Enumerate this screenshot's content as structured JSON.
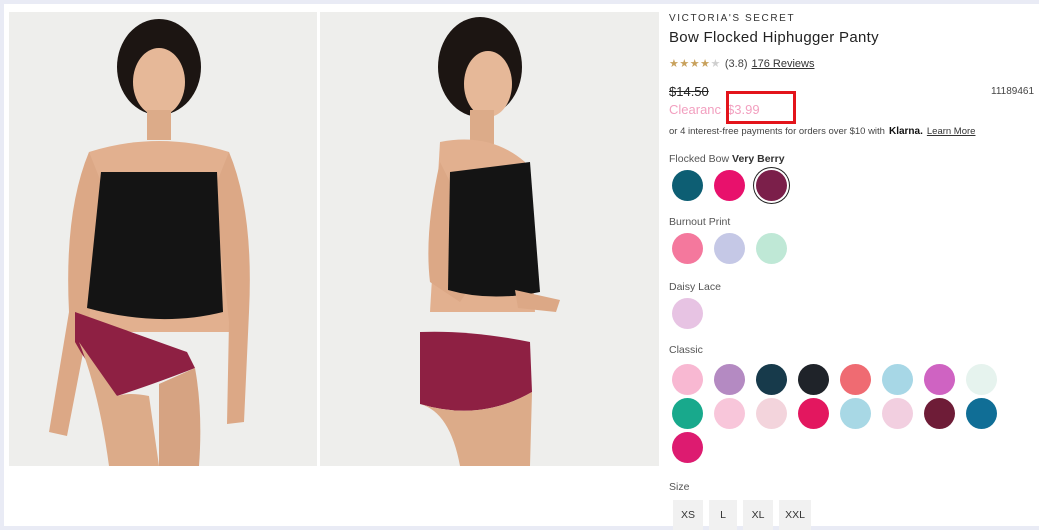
{
  "product": {
    "brand": "VICTORIA'S SECRET",
    "title": "Bow Flocked Hiphugger Panty",
    "rating": "(3.8)",
    "stars_filled": 4,
    "stars_total": 5,
    "reviews": "176 Reviews",
    "original_price": "$14.50",
    "sale_label": "Clearanc",
    "sale_price": "$3.99",
    "sku": "11189461",
    "klarna_text": "or 4 interest-free payments for orders over $10 with",
    "klarna_logo": "Klarna.",
    "learn_more": "Learn More"
  },
  "colors": {
    "accent_pink": "#f29fbf",
    "highlight_red": "#e3141b",
    "star_gold": "#c8a15c"
  },
  "swatch_groups": [
    {
      "label": "Flocked Bow",
      "selected": "Very Berry",
      "swatches": [
        {
          "name": "teal",
          "color": "#0d5e73"
        },
        {
          "name": "hot-pink",
          "color": "#e8116c"
        },
        {
          "name": "very-berry",
          "color": "#7b1f4a",
          "selected": true
        }
      ]
    },
    {
      "label": "Burnout Print",
      "swatches": [
        {
          "name": "pink-burnout",
          "color": "#f4789d"
        },
        {
          "name": "lavender-burnout",
          "color": "#c5c8e6"
        },
        {
          "name": "mint-burnout",
          "color": "#bfe8d6"
        }
      ]
    },
    {
      "label": "Daisy Lace",
      "swatches": [
        {
          "name": "lilac-lace",
          "color": "#e7c3e3"
        }
      ]
    },
    {
      "label": "Classic",
      "swatches": [
        {
          "name": "light-pink",
          "color": "#f8b8d2"
        },
        {
          "name": "purple-floral",
          "color": "#b48ac2"
        },
        {
          "name": "navy-floral",
          "color": "#173a4b"
        },
        {
          "name": "black-floral",
          "color": "#1f2329"
        },
        {
          "name": "coral",
          "color": "#ef6b72"
        },
        {
          "name": "light-blue",
          "color": "#a7d7e6"
        },
        {
          "name": "orchid",
          "color": "#cf63c2"
        },
        {
          "name": "white-stripe",
          "color": "#e6f3ee"
        },
        {
          "name": "emerald",
          "color": "#18a98c"
        },
        {
          "name": "blush",
          "color": "#f8c6da"
        },
        {
          "name": "pink-dot",
          "color": "#f3d4dc"
        },
        {
          "name": "fuchsia-stripe",
          "color": "#e3175f"
        },
        {
          "name": "sky-print",
          "color": "#a8d8e5"
        },
        {
          "name": "pink-tie-dye",
          "color": "#f2cfe0"
        },
        {
          "name": "burgundy-floral",
          "color": "#6e1c37"
        },
        {
          "name": "ocean-blue",
          "color": "#106e96"
        },
        {
          "name": "magenta-print",
          "color": "#dd1b70"
        }
      ]
    }
  ],
  "size": {
    "label": "Size",
    "options": [
      "XS",
      "L",
      "XL",
      "XXL"
    ]
  }
}
